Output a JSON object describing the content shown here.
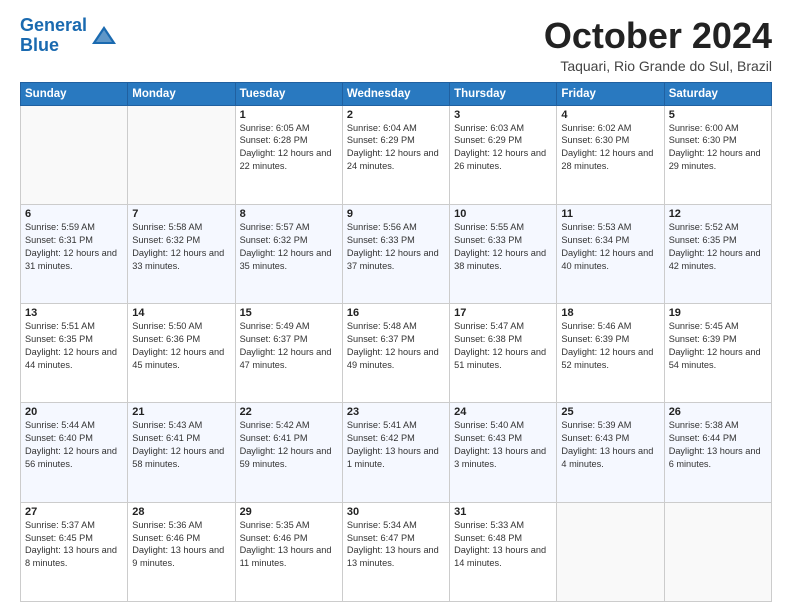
{
  "header": {
    "logo_line1": "General",
    "logo_line2": "Blue",
    "month": "October 2024",
    "location": "Taquari, Rio Grande do Sul, Brazil"
  },
  "weekdays": [
    "Sunday",
    "Monday",
    "Tuesday",
    "Wednesday",
    "Thursday",
    "Friday",
    "Saturday"
  ],
  "weeks": [
    [
      {
        "day": "",
        "sunrise": "",
        "sunset": "",
        "daylight": ""
      },
      {
        "day": "",
        "sunrise": "",
        "sunset": "",
        "daylight": ""
      },
      {
        "day": "1",
        "sunrise": "Sunrise: 6:05 AM",
        "sunset": "Sunset: 6:28 PM",
        "daylight": "Daylight: 12 hours and 22 minutes."
      },
      {
        "day": "2",
        "sunrise": "Sunrise: 6:04 AM",
        "sunset": "Sunset: 6:29 PM",
        "daylight": "Daylight: 12 hours and 24 minutes."
      },
      {
        "day": "3",
        "sunrise": "Sunrise: 6:03 AM",
        "sunset": "Sunset: 6:29 PM",
        "daylight": "Daylight: 12 hours and 26 minutes."
      },
      {
        "day": "4",
        "sunrise": "Sunrise: 6:02 AM",
        "sunset": "Sunset: 6:30 PM",
        "daylight": "Daylight: 12 hours and 28 minutes."
      },
      {
        "day": "5",
        "sunrise": "Sunrise: 6:00 AM",
        "sunset": "Sunset: 6:30 PM",
        "daylight": "Daylight: 12 hours and 29 minutes."
      }
    ],
    [
      {
        "day": "6",
        "sunrise": "Sunrise: 5:59 AM",
        "sunset": "Sunset: 6:31 PM",
        "daylight": "Daylight: 12 hours and 31 minutes."
      },
      {
        "day": "7",
        "sunrise": "Sunrise: 5:58 AM",
        "sunset": "Sunset: 6:32 PM",
        "daylight": "Daylight: 12 hours and 33 minutes."
      },
      {
        "day": "8",
        "sunrise": "Sunrise: 5:57 AM",
        "sunset": "Sunset: 6:32 PM",
        "daylight": "Daylight: 12 hours and 35 minutes."
      },
      {
        "day": "9",
        "sunrise": "Sunrise: 5:56 AM",
        "sunset": "Sunset: 6:33 PM",
        "daylight": "Daylight: 12 hours and 37 minutes."
      },
      {
        "day": "10",
        "sunrise": "Sunrise: 5:55 AM",
        "sunset": "Sunset: 6:33 PM",
        "daylight": "Daylight: 12 hours and 38 minutes."
      },
      {
        "day": "11",
        "sunrise": "Sunrise: 5:53 AM",
        "sunset": "Sunset: 6:34 PM",
        "daylight": "Daylight: 12 hours and 40 minutes."
      },
      {
        "day": "12",
        "sunrise": "Sunrise: 5:52 AM",
        "sunset": "Sunset: 6:35 PM",
        "daylight": "Daylight: 12 hours and 42 minutes."
      }
    ],
    [
      {
        "day": "13",
        "sunrise": "Sunrise: 5:51 AM",
        "sunset": "Sunset: 6:35 PM",
        "daylight": "Daylight: 12 hours and 44 minutes."
      },
      {
        "day": "14",
        "sunrise": "Sunrise: 5:50 AM",
        "sunset": "Sunset: 6:36 PM",
        "daylight": "Daylight: 12 hours and 45 minutes."
      },
      {
        "day": "15",
        "sunrise": "Sunrise: 5:49 AM",
        "sunset": "Sunset: 6:37 PM",
        "daylight": "Daylight: 12 hours and 47 minutes."
      },
      {
        "day": "16",
        "sunrise": "Sunrise: 5:48 AM",
        "sunset": "Sunset: 6:37 PM",
        "daylight": "Daylight: 12 hours and 49 minutes."
      },
      {
        "day": "17",
        "sunrise": "Sunrise: 5:47 AM",
        "sunset": "Sunset: 6:38 PM",
        "daylight": "Daylight: 12 hours and 51 minutes."
      },
      {
        "day": "18",
        "sunrise": "Sunrise: 5:46 AM",
        "sunset": "Sunset: 6:39 PM",
        "daylight": "Daylight: 12 hours and 52 minutes."
      },
      {
        "day": "19",
        "sunrise": "Sunrise: 5:45 AM",
        "sunset": "Sunset: 6:39 PM",
        "daylight": "Daylight: 12 hours and 54 minutes."
      }
    ],
    [
      {
        "day": "20",
        "sunrise": "Sunrise: 5:44 AM",
        "sunset": "Sunset: 6:40 PM",
        "daylight": "Daylight: 12 hours and 56 minutes."
      },
      {
        "day": "21",
        "sunrise": "Sunrise: 5:43 AM",
        "sunset": "Sunset: 6:41 PM",
        "daylight": "Daylight: 12 hours and 58 minutes."
      },
      {
        "day": "22",
        "sunrise": "Sunrise: 5:42 AM",
        "sunset": "Sunset: 6:41 PM",
        "daylight": "Daylight: 12 hours and 59 minutes."
      },
      {
        "day": "23",
        "sunrise": "Sunrise: 5:41 AM",
        "sunset": "Sunset: 6:42 PM",
        "daylight": "Daylight: 13 hours and 1 minute."
      },
      {
        "day": "24",
        "sunrise": "Sunrise: 5:40 AM",
        "sunset": "Sunset: 6:43 PM",
        "daylight": "Daylight: 13 hours and 3 minutes."
      },
      {
        "day": "25",
        "sunrise": "Sunrise: 5:39 AM",
        "sunset": "Sunset: 6:43 PM",
        "daylight": "Daylight: 13 hours and 4 minutes."
      },
      {
        "day": "26",
        "sunrise": "Sunrise: 5:38 AM",
        "sunset": "Sunset: 6:44 PM",
        "daylight": "Daylight: 13 hours and 6 minutes."
      }
    ],
    [
      {
        "day": "27",
        "sunrise": "Sunrise: 5:37 AM",
        "sunset": "Sunset: 6:45 PM",
        "daylight": "Daylight: 13 hours and 8 minutes."
      },
      {
        "day": "28",
        "sunrise": "Sunrise: 5:36 AM",
        "sunset": "Sunset: 6:46 PM",
        "daylight": "Daylight: 13 hours and 9 minutes."
      },
      {
        "day": "29",
        "sunrise": "Sunrise: 5:35 AM",
        "sunset": "Sunset: 6:46 PM",
        "daylight": "Daylight: 13 hours and 11 minutes."
      },
      {
        "day": "30",
        "sunrise": "Sunrise: 5:34 AM",
        "sunset": "Sunset: 6:47 PM",
        "daylight": "Daylight: 13 hours and 13 minutes."
      },
      {
        "day": "31",
        "sunrise": "Sunrise: 5:33 AM",
        "sunset": "Sunset: 6:48 PM",
        "daylight": "Daylight: 13 hours and 14 minutes."
      },
      {
        "day": "",
        "sunrise": "",
        "sunset": "",
        "daylight": ""
      },
      {
        "day": "",
        "sunrise": "",
        "sunset": "",
        "daylight": ""
      }
    ]
  ]
}
